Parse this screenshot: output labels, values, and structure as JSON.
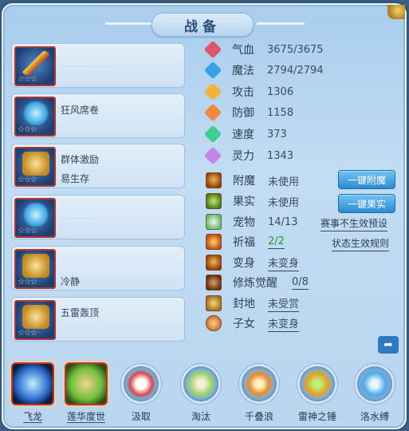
{
  "window": {
    "title": "战备"
  },
  "slots": [
    {
      "line1": "",
      "line2": "",
      "stars": "☆☆☆",
      "art": "sword"
    },
    {
      "line1": "狂风席卷",
      "line2": "",
      "stars": "☆☆☆",
      "art": "blue"
    },
    {
      "line1": "群体激励",
      "line2": "易生存",
      "stars": "☆☆☆",
      "art": "gold"
    },
    {
      "line1": "",
      "line2": "",
      "stars": "☆☆☆",
      "art": "blue"
    },
    {
      "line1": "冷静",
      "line2": "",
      "stars": "☆☆☆",
      "art": "gold"
    },
    {
      "line1": "五雷轰顶",
      "line2": "",
      "stars": "☆☆☆",
      "art": "gold"
    }
  ],
  "stats": [
    {
      "label": "气血",
      "value": "3675/3675",
      "color": "#e2546a",
      "icon": "heart-gem-icon"
    },
    {
      "label": "魔法",
      "value": "2794/2794",
      "color": "#3aa0e8",
      "icon": "mana-gem-icon"
    },
    {
      "label": "攻击",
      "value": "1306",
      "color": "#f3b339",
      "icon": "attack-gem-icon"
    },
    {
      "label": "防御",
      "value": "1158",
      "color": "#f08a3c",
      "icon": "defense-gem-icon"
    },
    {
      "label": "速度",
      "value": "373",
      "color": "#3ccf8e",
      "icon": "speed-gem-icon"
    },
    {
      "label": "灵力",
      "value": "1343",
      "color": "#c786e6",
      "icon": "spirit-gem-icon"
    }
  ],
  "props": [
    {
      "label": "附魔",
      "value": "未使用",
      "underline": false,
      "value_color": "#3d4c5d"
    },
    {
      "label": "果实",
      "value": "未使用",
      "underline": false,
      "value_color": "#3d4c5d"
    },
    {
      "label": "宠物",
      "value": "14/13",
      "underline": false,
      "value_color": "#3d4c5d"
    },
    {
      "label": "祈福",
      "value": "2/2",
      "underline": true,
      "value_color": "#17a32b"
    },
    {
      "label": "变身",
      "value": "未变身",
      "underline": true,
      "value_color": "#3d4c5d"
    },
    {
      "label": "修炼觉醒",
      "value": "0/8",
      "underline": true,
      "value_color": "#3d4c5d"
    },
    {
      "label": "封地",
      "value": "未受赏",
      "underline": true,
      "value_color": "#3d4c5d"
    },
    {
      "label": "子女",
      "value": "未变身",
      "underline": true,
      "value_color": "#3d4c5d"
    }
  ],
  "buttons": {
    "enchant": "一键附魔",
    "fruit": "一键果实"
  },
  "links": {
    "preset": "赛事不生效预设",
    "rules": "状态生效规则"
  },
  "skills": [
    {
      "name": "飞龙",
      "style": "square",
      "color": "#2d6fd0"
    },
    {
      "name": "莲华度世",
      "style": "square",
      "color": "#6fbf3c"
    },
    {
      "name": "汲取",
      "style": "orb",
      "color": "#d84a4a"
    },
    {
      "name": "淘汰",
      "style": "orb",
      "color": "#9ccf6a"
    },
    {
      "name": "千叠浪",
      "style": "orb",
      "color": "#e88a30"
    },
    {
      "name": "雷神之锤",
      "style": "orb",
      "color": "#e6a020"
    },
    {
      "name": "洛水缚",
      "style": "orb",
      "color": "#4fa8e6"
    }
  ]
}
